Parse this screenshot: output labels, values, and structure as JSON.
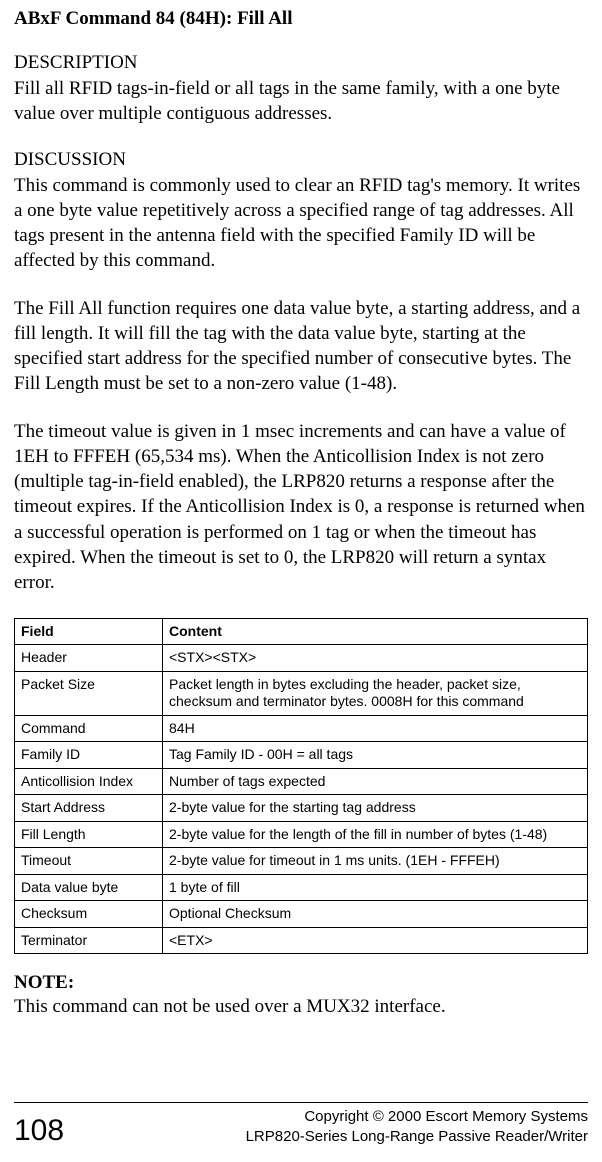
{
  "page_title": "ABxF Command 84 (84H): Fill All",
  "description": {
    "heading": "DESCRIPTION",
    "text": "Fill all RFID tags-in-field or all tags in the same family, with a one byte value over multiple contiguous addresses."
  },
  "discussion": {
    "heading": "DISCUSSION",
    "p1": "This command is commonly used to clear an RFID tag's memory. It writes a one byte value repetitively across a specified range of tag addresses.  All tags present in the antenna field with the specified Family ID will be affected by this command.",
    "p2": "The Fill All function requires one data value byte, a starting address, and a fill length.  It will fill the tag with the data value byte, starting at the specified start address for the specified number of consecutive bytes. The Fill Length must be set to a non-zero value (1-48).",
    "p3": "The timeout value is given in 1 msec increments and can have a value of 1EH to FFFEH (65,534 ms).  When the Anticollision Index is not zero (multiple tag-in-field enabled), the LRP820 returns a response after the timeout expires. If the Anticollision Index is 0, a response is returned when a successful operation is performed on 1 tag or when the timeout has expired. When the timeout is set to 0, the LRP820 will return a syntax error."
  },
  "table": {
    "headers": {
      "field": "Field",
      "content": "Content"
    },
    "rows": [
      {
        "field": "Header",
        "content": "<STX><STX>"
      },
      {
        "field": "Packet Size",
        "content": "Packet length in bytes excluding the header, packet size, checksum and terminator bytes. 0008H for this command"
      },
      {
        "field": "Command",
        "content": "84H"
      },
      {
        "field": "Family ID",
        "content": "Tag Family ID - 00H = all tags"
      },
      {
        "field": "Anticollision Index",
        "content": "Number of tags expected"
      },
      {
        "field": "Start Address",
        "content": "2-byte value for the starting tag address"
      },
      {
        "field": "Fill Length",
        "content": "2-byte value for the length of the fill in number of bytes (1-48)"
      },
      {
        "field": "Timeout",
        "content": "2-byte value for timeout in 1 ms units. (1EH - FFFEH)"
      },
      {
        "field": "Data value byte",
        "content": "1 byte of fill"
      },
      {
        "field": "Checksum",
        "content": "Optional Checksum"
      },
      {
        "field": "Terminator",
        "content": "<ETX>"
      }
    ]
  },
  "note": {
    "heading": "NOTE:",
    "text": "This command can not be used over a MUX32 interface."
  },
  "footer": {
    "page_number": "108",
    "line1": "Copyright © 2000 Escort Memory Systems",
    "line2": "LRP820-Series Long-Range Passive Reader/Writer"
  }
}
